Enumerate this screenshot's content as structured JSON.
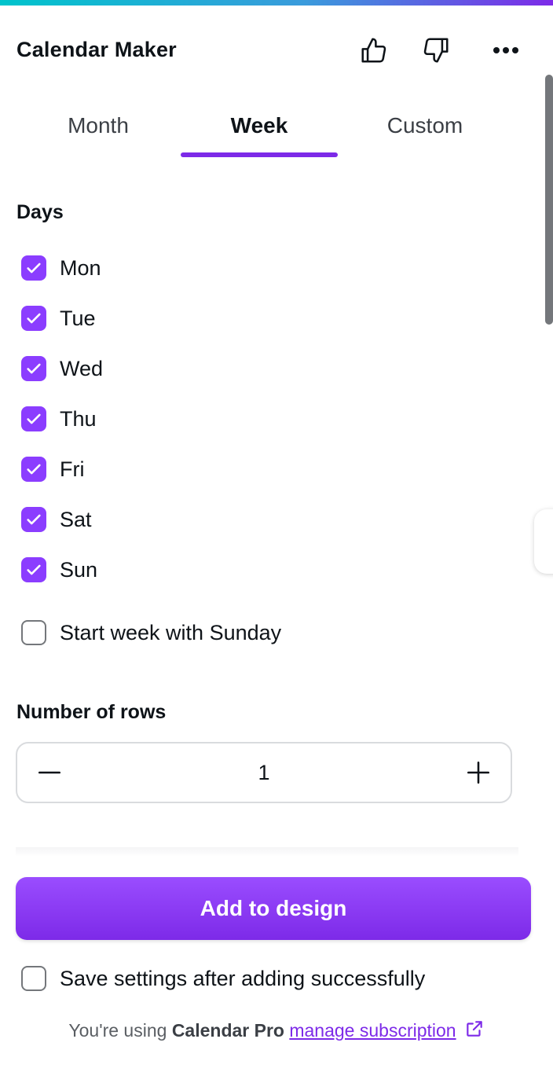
{
  "app": {
    "title": "Calendar Maker"
  },
  "header_icons": [
    "thumbs-up-icon",
    "thumbs-down-icon",
    "more-options-icon"
  ],
  "tabs": [
    {
      "label": "Month",
      "active": false
    },
    {
      "label": "Week",
      "active": true
    },
    {
      "label": "Custom",
      "active": false
    }
  ],
  "days_section": {
    "title": "Days",
    "days": [
      {
        "label": "Mon",
        "checked": true
      },
      {
        "label": "Tue",
        "checked": true
      },
      {
        "label": "Wed",
        "checked": true
      },
      {
        "label": "Thu",
        "checked": true
      },
      {
        "label": "Fri",
        "checked": true
      },
      {
        "label": "Sat",
        "checked": true
      },
      {
        "label": "Sun",
        "checked": true
      }
    ],
    "start_sunday": {
      "label": "Start week with Sunday",
      "checked": false
    }
  },
  "rows_section": {
    "title": "Number of rows",
    "value": "1"
  },
  "add_button": {
    "label": "Add to design"
  },
  "save_settings": {
    "label": "Save settings after adding successfully",
    "checked": false
  },
  "footer": {
    "prefix": "You're using ",
    "plan": "Calendar Pro",
    "link": "manage subscription"
  },
  "colors": {
    "accent": "#8b3dff",
    "accent_dark": "#7d2ae8",
    "text": "#0e1318"
  }
}
